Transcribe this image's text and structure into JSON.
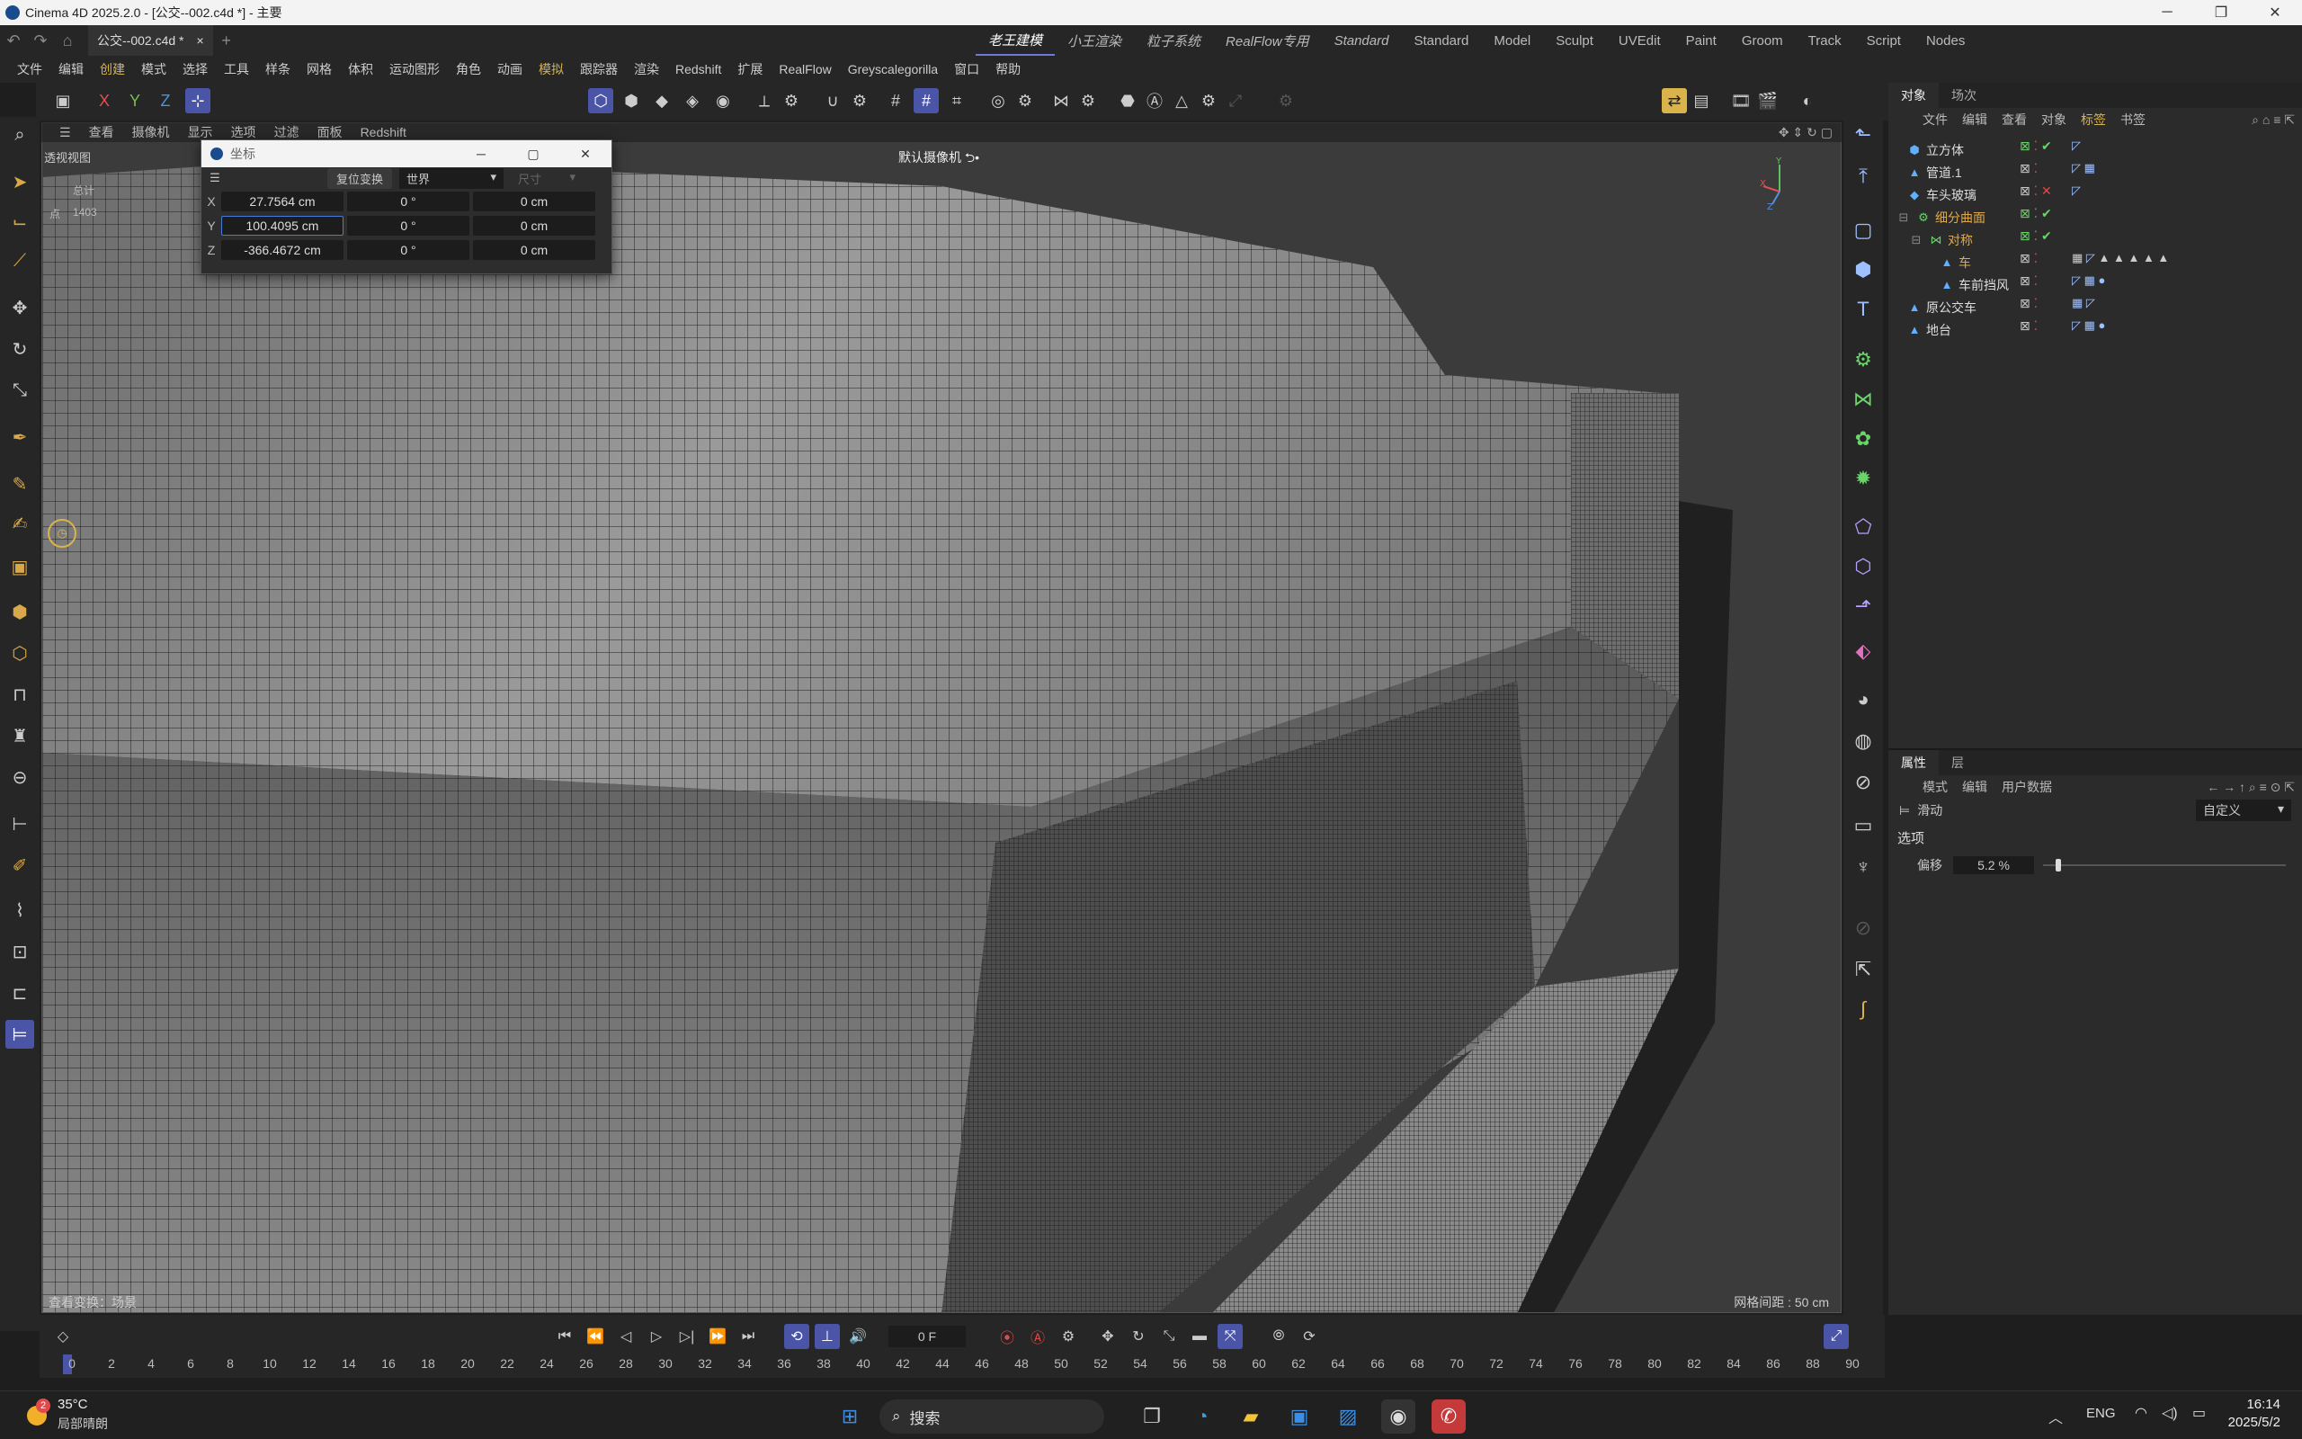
{
  "window": {
    "title": "Cinema 4D 2025.2.0 - [公交--002.c4d *] - 主要",
    "controls": [
      "─",
      "❐",
      "✕"
    ]
  },
  "tabs": {
    "doc_tab": "公交--002.c4d *",
    "close": "×",
    "add": "+",
    "layouts": [
      "老王建模",
      "小王渲染",
      "粒子系统",
      "RealFlow专用",
      "Standard",
      "Standard",
      "Model",
      "Sculpt",
      "UVEdit",
      "Paint",
      "Groom",
      "Track",
      "Script",
      "Nodes"
    ]
  },
  "menu": [
    "文件",
    "编辑",
    "创建",
    "模式",
    "选择",
    "工具",
    "样条",
    "网格",
    "体积",
    "运动图形",
    "角色",
    "动画",
    "模拟",
    "跟踪器",
    "渲染",
    "Redshift",
    "扩展",
    "RealFlow",
    "Greyscalegorilla",
    "窗口",
    "帮助"
  ],
  "axis_toggles": [
    "X",
    "Y",
    "Z"
  ],
  "viewport": {
    "menu": [
      "查看",
      "摄像机",
      "显示",
      "选项",
      "过滤",
      "面板",
      "Redshift"
    ],
    "name": "透视视图",
    "camera": "默认摄像机 ⮌•",
    "stats_label": "总计",
    "stats_point_label": "点",
    "stats_point_value": "1403",
    "status_left": "查看变换：场景",
    "status_right": "网格间距 : 50 cm"
  },
  "coord_window": {
    "title": "坐标",
    "reset_button": "复位变换",
    "space": "世界",
    "size_mode": "尺寸",
    "rows": [
      {
        "axis": "X",
        "pos": "27.7564 cm",
        "rot": "0 °",
        "size": "0 cm"
      },
      {
        "axis": "Y",
        "pos": "100.4095 cm",
        "rot": "0 °",
        "size": "0 cm"
      },
      {
        "axis": "Z",
        "pos": "-366.4672 cm",
        "rot": "0 °",
        "size": "0 cm"
      }
    ]
  },
  "object_panel": {
    "tabs": [
      "对象",
      "场次"
    ],
    "menu": [
      "文件",
      "编辑",
      "查看",
      "对象",
      "标签",
      "书签"
    ],
    "objects": [
      {
        "name": "立方体",
        "icon": "cube-icon",
        "indent": 0
      },
      {
        "name": "管道.1",
        "icon": "tube-icon",
        "indent": 0
      },
      {
        "name": "车头玻璃",
        "icon": "diamond-icon",
        "indent": 0
      },
      {
        "name": "细分曲面",
        "icon": "subdivision-icon",
        "indent": 0
      },
      {
        "name": "对称",
        "icon": "symmetry-icon",
        "indent": 1
      },
      {
        "name": "车",
        "icon": "polygon-icon",
        "indent": 2
      },
      {
        "name": "车前挡风",
        "icon": "polygon-icon",
        "indent": 2
      },
      {
        "name": "原公交车",
        "icon": "polygon-icon",
        "indent": 0
      },
      {
        "name": "地台",
        "icon": "polygon-icon",
        "indent": 0
      }
    ]
  },
  "attr_panel": {
    "tabs": [
      "属性",
      "层"
    ],
    "menu": [
      "模式",
      "编辑",
      "用户数据"
    ],
    "object_type": "滑动",
    "preset": "自定义",
    "section": "选项",
    "offset_label": "偏移",
    "offset_value": "5.2 %",
    "offset_fraction": 0.052
  },
  "timeline": {
    "frame": "0 F",
    "ticks": [
      "0",
      "2",
      "4",
      "6",
      "8",
      "10",
      "12",
      "14",
      "16",
      "18",
      "20",
      "22",
      "24",
      "26",
      "28",
      "30",
      "32",
      "34",
      "36",
      "38",
      "40",
      "42",
      "44",
      "46",
      "48",
      "50",
      "52",
      "54",
      "56",
      "58",
      "60",
      "62",
      "64",
      "66",
      "68",
      "70",
      "72",
      "74",
      "76",
      "78",
      "80",
      "82",
      "84",
      "86",
      "88",
      "90"
    ]
  },
  "taskbar": {
    "temperature": "35°C",
    "weather": "局部晴朗",
    "weather_badge": "2",
    "search": "搜索",
    "lang": "ENG",
    "time": "16:14",
    "date": "2025/5/2"
  },
  "colors": {
    "accent": "#4a55a8",
    "panel": "#2b2b2b",
    "viewport": "#3a3a3a",
    "highlight_text": "#d9b44a"
  }
}
